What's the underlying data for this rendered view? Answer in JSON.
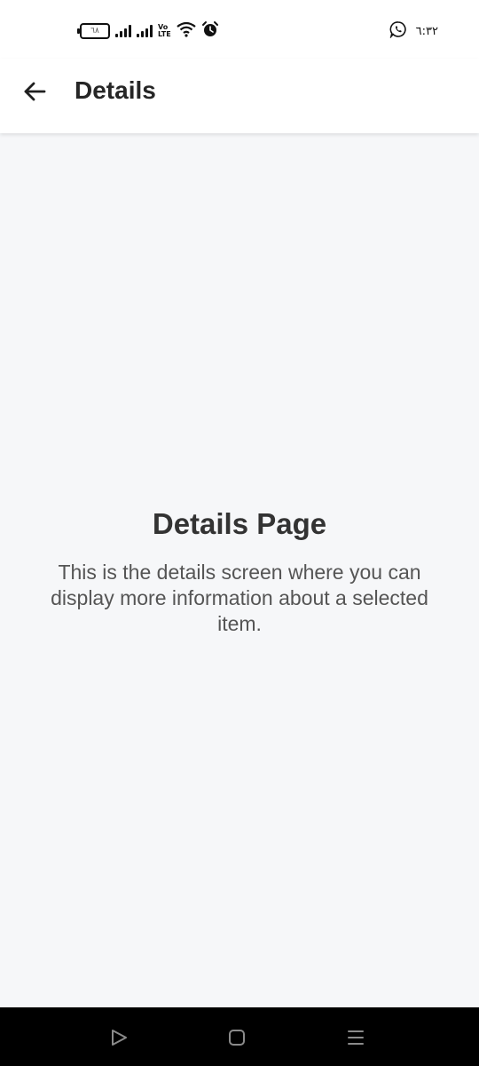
{
  "status_bar": {
    "battery_level": "٦٨",
    "volte": [
      "Vo",
      "LTE"
    ],
    "time": "٦:٣٢",
    "icons": [
      "battery-icon",
      "signal-icon",
      "signal-icon",
      "volte-icon",
      "wifi-icon",
      "alarm-icon",
      "whatsapp-icon"
    ]
  },
  "app_bar": {
    "title": "Details"
  },
  "main": {
    "heading": "Details Page",
    "description": "This is the details screen where you can display more information about a selected item."
  },
  "nav_bar": {
    "buttons": [
      "back-nav-icon",
      "home-nav-icon",
      "recents-nav-icon"
    ]
  },
  "colors": {
    "background": "#f6f7f9",
    "app_bar": "#ffffff",
    "nav_bar": "#000000",
    "heading_text": "#333333",
    "body_text": "#555555"
  }
}
